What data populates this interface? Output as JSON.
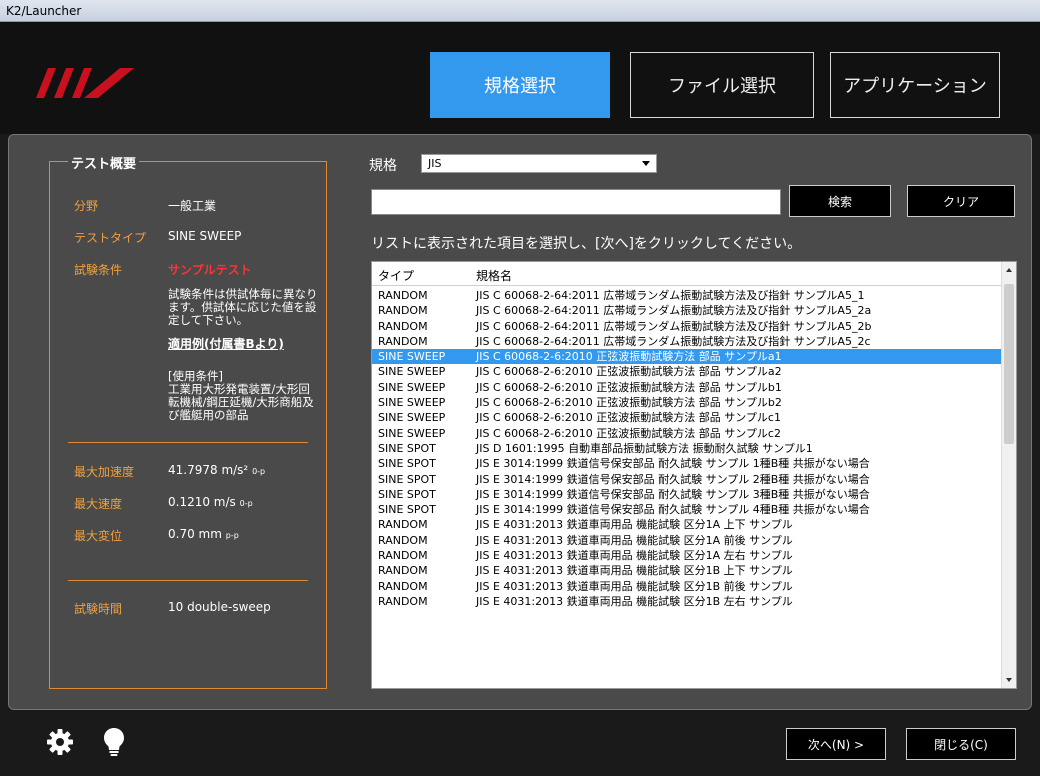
{
  "window": {
    "title": "K2/Launcher"
  },
  "header": {
    "tabs": [
      {
        "label": "規格選択",
        "active": true
      },
      {
        "label": "ファイル選択",
        "active": false
      },
      {
        "label": "アプリケーション",
        "active": false
      }
    ]
  },
  "summary": {
    "title": "テスト概要",
    "field_label": "分野",
    "field_value": "一般工業",
    "test_type_label": "テストタイプ",
    "test_type_value": "SINE SWEEP",
    "condition_label": "試験条件",
    "condition_value": "サンプルテスト",
    "condition_note": "試験条件は供試体毎に異なります。供試体に応じた値を設定して下さい。",
    "example_title": "適用例(付属書Bより)",
    "example_text": "[使用条件]\n工業用大形発電装置/大形回転機械/鋼圧延機/大形商船及び艦艇用の部品",
    "max_accel_label": "最大加速度",
    "max_accel_value": "41.7978 m/s²",
    "max_accel_sub": "0-p",
    "max_vel_label": "最大速度",
    "max_vel_value": "0.1210 m/s",
    "max_vel_sub": "0-p",
    "max_disp_label": "最大変位",
    "max_disp_value": "0.70 mm",
    "max_disp_sub": "p-p",
    "time_label": "試験時間",
    "time_value": "10 double-sweep"
  },
  "standard": {
    "label": "規格",
    "selected": "JIS"
  },
  "search": {
    "value": "",
    "search_label": "検索",
    "clear_label": "クリア"
  },
  "instruction": "リストに表示された項目を選択し、[次へ]をクリックしてください。",
  "list": {
    "headers": {
      "type": "タイプ",
      "name": "規格名"
    },
    "rows": [
      {
        "type": "RANDOM",
        "name": "JIS C 60068-2-64:2011 広帯域ランダム振動試験方法及び指針 サンプルA5_1",
        "selected": false
      },
      {
        "type": "RANDOM",
        "name": "JIS C 60068-2-64:2011 広帯域ランダム振動試験方法及び指針 サンプルA5_2a",
        "selected": false
      },
      {
        "type": "RANDOM",
        "name": "JIS C 60068-2-64:2011 広帯域ランダム振動試験方法及び指針 サンプルA5_2b",
        "selected": false
      },
      {
        "type": "RANDOM",
        "name": "JIS C 60068-2-64:2011 広帯域ランダム振動試験方法及び指針 サンプルA5_2c",
        "selected": false
      },
      {
        "type": "SINE SWEEP",
        "name": "JIS C 60068-2-6:2010 正弦波振動試験方法 部品 サンプルa1",
        "selected": true
      },
      {
        "type": "SINE SWEEP",
        "name": "JIS C 60068-2-6:2010 正弦波振動試験方法 部品 サンプルa2",
        "selected": false
      },
      {
        "type": "SINE SWEEP",
        "name": "JIS C 60068-2-6:2010 正弦波振動試験方法 部品 サンプルb1",
        "selected": false
      },
      {
        "type": "SINE SWEEP",
        "name": "JIS C 60068-2-6:2010 正弦波振動試験方法 部品 サンプルb2",
        "selected": false
      },
      {
        "type": "SINE SWEEP",
        "name": "JIS C 60068-2-6:2010 正弦波振動試験方法 部品 サンプルc1",
        "selected": false
      },
      {
        "type": "SINE SWEEP",
        "name": "JIS C 60068-2-6:2010 正弦波振動試験方法 部品 サンプルc2",
        "selected": false
      },
      {
        "type": "SINE SPOT",
        "name": "JIS D 1601:1995 自動車部品振動試験方法 振動耐久試験 サンプル1",
        "selected": false
      },
      {
        "type": "SINE SPOT",
        "name": "JIS E 3014:1999 鉄道信号保安部品 耐久試験 サンプル 1種B種 共振がない場合",
        "selected": false
      },
      {
        "type": "SINE SPOT",
        "name": "JIS E 3014:1999 鉄道信号保安部品 耐久試験 サンプル 2種B種 共振がない場合",
        "selected": false
      },
      {
        "type": "SINE SPOT",
        "name": "JIS E 3014:1999 鉄道信号保安部品 耐久試験 サンプル 3種B種 共振がない場合",
        "selected": false
      },
      {
        "type": "SINE SPOT",
        "name": "JIS E 3014:1999 鉄道信号保安部品 耐久試験 サンプル 4種B種 共振がない場合",
        "selected": false
      },
      {
        "type": "RANDOM",
        "name": "JIS E 4031:2013 鉄道車両用品 機能試験 区分1A 上下 サンプル",
        "selected": false
      },
      {
        "type": "RANDOM",
        "name": "JIS E 4031:2013 鉄道車両用品 機能試験 区分1A 前後 サンプル",
        "selected": false
      },
      {
        "type": "RANDOM",
        "name": "JIS E 4031:2013 鉄道車両用品 機能試験 区分1A 左右 サンプル",
        "selected": false
      },
      {
        "type": "RANDOM",
        "name": "JIS E 4031:2013 鉄道車両用品 機能試験 区分1B 上下 サンプル",
        "selected": false
      },
      {
        "type": "RANDOM",
        "name": "JIS E 4031:2013 鉄道車両用品 機能試験 区分1B 前後 サンプル",
        "selected": false
      },
      {
        "type": "RANDOM",
        "name": "JIS E 4031:2013 鉄道車両用品 機能試験 区分1B 左右 サンプル",
        "selected": false
      }
    ]
  },
  "footer": {
    "next_label": "次へ(N) >",
    "close_label": "閉じる(C)"
  },
  "colors": {
    "accent": "#3399ee",
    "label_orange": "#f0a040",
    "red": "#ff3333"
  },
  "icons": [
    "logo",
    "gear-icon",
    "lightbulb-icon"
  ]
}
